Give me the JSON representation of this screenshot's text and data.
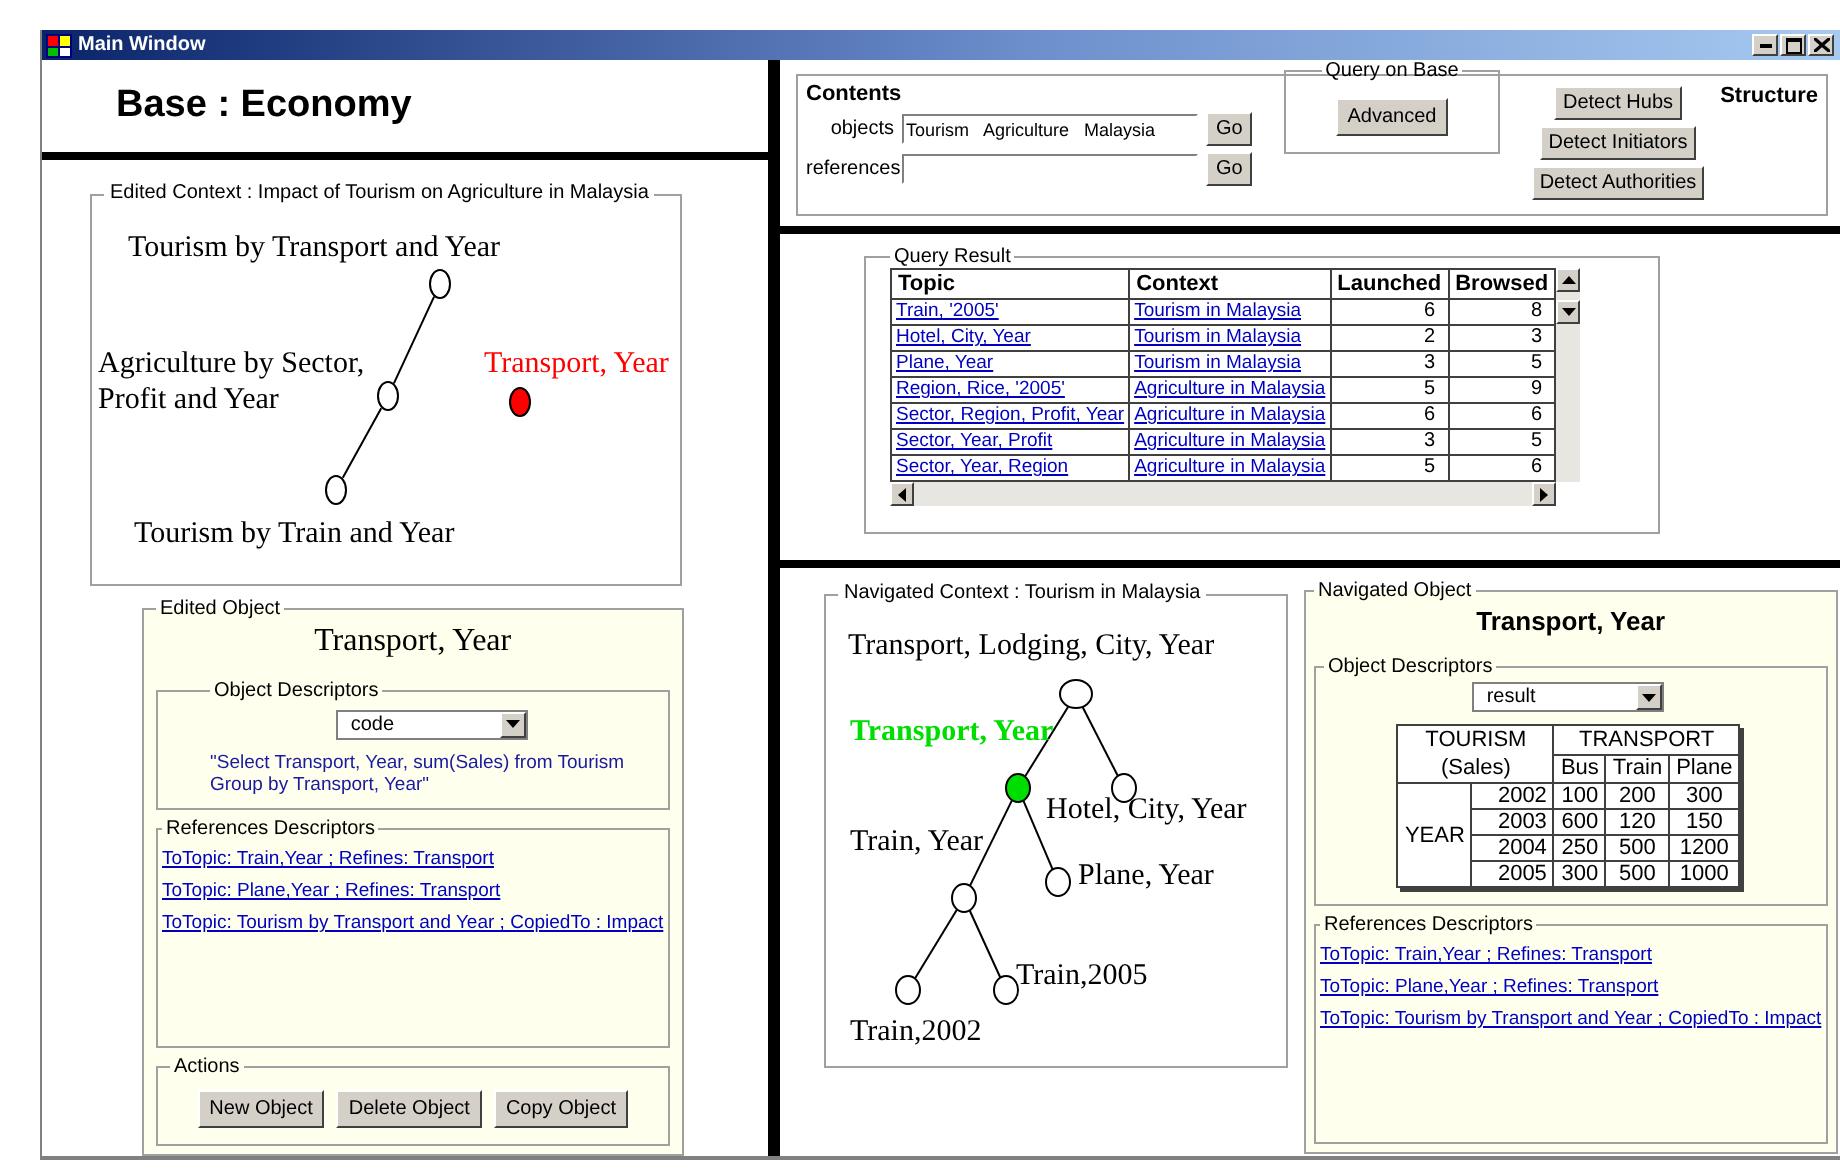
{
  "window": {
    "title": "Main Window"
  },
  "base_header": {
    "text": "Base : Economy"
  },
  "edited_context": {
    "legend": "Edited Context : Impact of Tourism on Agriculture in Malaysia",
    "nodes": [
      {
        "label": "Tourism by Transport and Year",
        "selected": false,
        "children": [
          {
            "label": "Agriculture by Sector, Profit and Year",
            "selected": false,
            "children": [
              {
                "label": "Tourism by Train and Year",
                "selected": false
              }
            ]
          }
        ]
      },
      {
        "label": "Transport, Year",
        "selected": true
      }
    ]
  },
  "edited_object": {
    "legend": "Edited Object",
    "title": "Transport, Year",
    "descriptors": {
      "legend": "Object Descriptors",
      "dropdown": "code",
      "code_text": "\"Select Transport, Year, sum(Sales) from Tourism Group by Transport, Year\""
    },
    "references": {
      "legend": "References Descriptors",
      "links": [
        "ToTopic: Train,Year ;  Refines: Transport",
        "ToTopic: Plane,Year ;  Refines: Transport",
        "ToTopic: Tourism by Transport and Year ; CopiedTo : Impact"
      ]
    },
    "actions": {
      "legend": "Actions",
      "buttons": [
        "New Object",
        "Delete Object",
        "Copy Object"
      ]
    }
  },
  "contents": {
    "title": "Contents",
    "objects_label": "objects",
    "objects_value": "Tourism   Agriculture   Malaysia",
    "objects_go": "Go",
    "references_label": "references",
    "references_go": "Go"
  },
  "query_on_base": {
    "legend": "Query on  Base",
    "button": "Advanced"
  },
  "structure": {
    "title": "Structure",
    "buttons": [
      "Detect Hubs",
      "Detect  Initiators",
      "Detect Authorities"
    ]
  },
  "query_result": {
    "legend": "Query Result",
    "columns": [
      "Topic",
      "Context",
      "Launched",
      "Browsed"
    ],
    "rows": [
      {
        "topic": "Train, '2005'",
        "context": "Tourism in Malaysia",
        "launched": "6",
        "browsed": "8"
      },
      {
        "topic": "Hotel, City, Year",
        "context": "Tourism in Malaysia",
        "launched": "2",
        "browsed": "3"
      },
      {
        "topic": "Plane, Year",
        "context": "Tourism in Malaysia",
        "launched": "3",
        "browsed": "5"
      },
      {
        "topic": "Region, Rice, '2005'",
        "context": "Agriculture in Malaysia",
        "launched": "5",
        "browsed": "9"
      },
      {
        "topic": "Sector, Region, Profit, Year",
        "context": "Agriculture in Malaysia",
        "launched": "6",
        "browsed": "6"
      },
      {
        "topic": "Sector, Year, Profit",
        "context": "Agriculture in Malaysia",
        "launched": "3",
        "browsed": "5"
      },
      {
        "topic": "Sector, Year, Region",
        "context": "Agriculture in Malaysia",
        "launched": "5",
        "browsed": "6"
      }
    ]
  },
  "navigated_context": {
    "legend": "Navigated Context : Tourism in Malaysia",
    "nodes": [
      {
        "label": "Transport, Lodging, City, Year",
        "selected": false,
        "children": [
          {
            "label": "Transport, Year",
            "selected": true,
            "children": [
              {
                "label": "Train, Year",
                "selected": false,
                "children": [
                  {
                    "label": "Train,2002",
                    "selected": false
                  },
                  {
                    "label": "Train,2005",
                    "selected": false
                  }
                ]
              },
              {
                "label": "Plane, Year",
                "selected": false
              }
            ]
          },
          {
            "label": "Hotel, City, Year",
            "selected": false
          }
        ]
      }
    ]
  },
  "navigated_object": {
    "legend": "Navigated Object",
    "title": "Transport, Year",
    "descriptors": {
      "legend": "Object Descriptors",
      "dropdown": "result",
      "table": {
        "corner": "TOURISM (Sales)",
        "column_group": "TRANSPORT",
        "columns": [
          "Bus",
          "Train",
          "Plane"
        ],
        "row_group": "YEAR",
        "rows": [
          {
            "year": "2002",
            "values": [
              "100",
              "200",
              "300"
            ]
          },
          {
            "year": "2003",
            "values": [
              "600",
              "120",
              "150"
            ]
          },
          {
            "year": "2004",
            "values": [
              "250",
              "500",
              "1200"
            ]
          },
          {
            "year": "2005",
            "values": [
              "300",
              "500",
              "1000"
            ]
          }
        ]
      }
    },
    "references": {
      "legend": "References Descriptors",
      "links": [
        "ToTopic: Train,Year ;  Refines: Transport",
        "ToTopic: Plane,Year ;  Refines: Transport",
        "ToTopic: Tourism by Transport and Year ; CopiedTo : Impact"
      ]
    }
  }
}
